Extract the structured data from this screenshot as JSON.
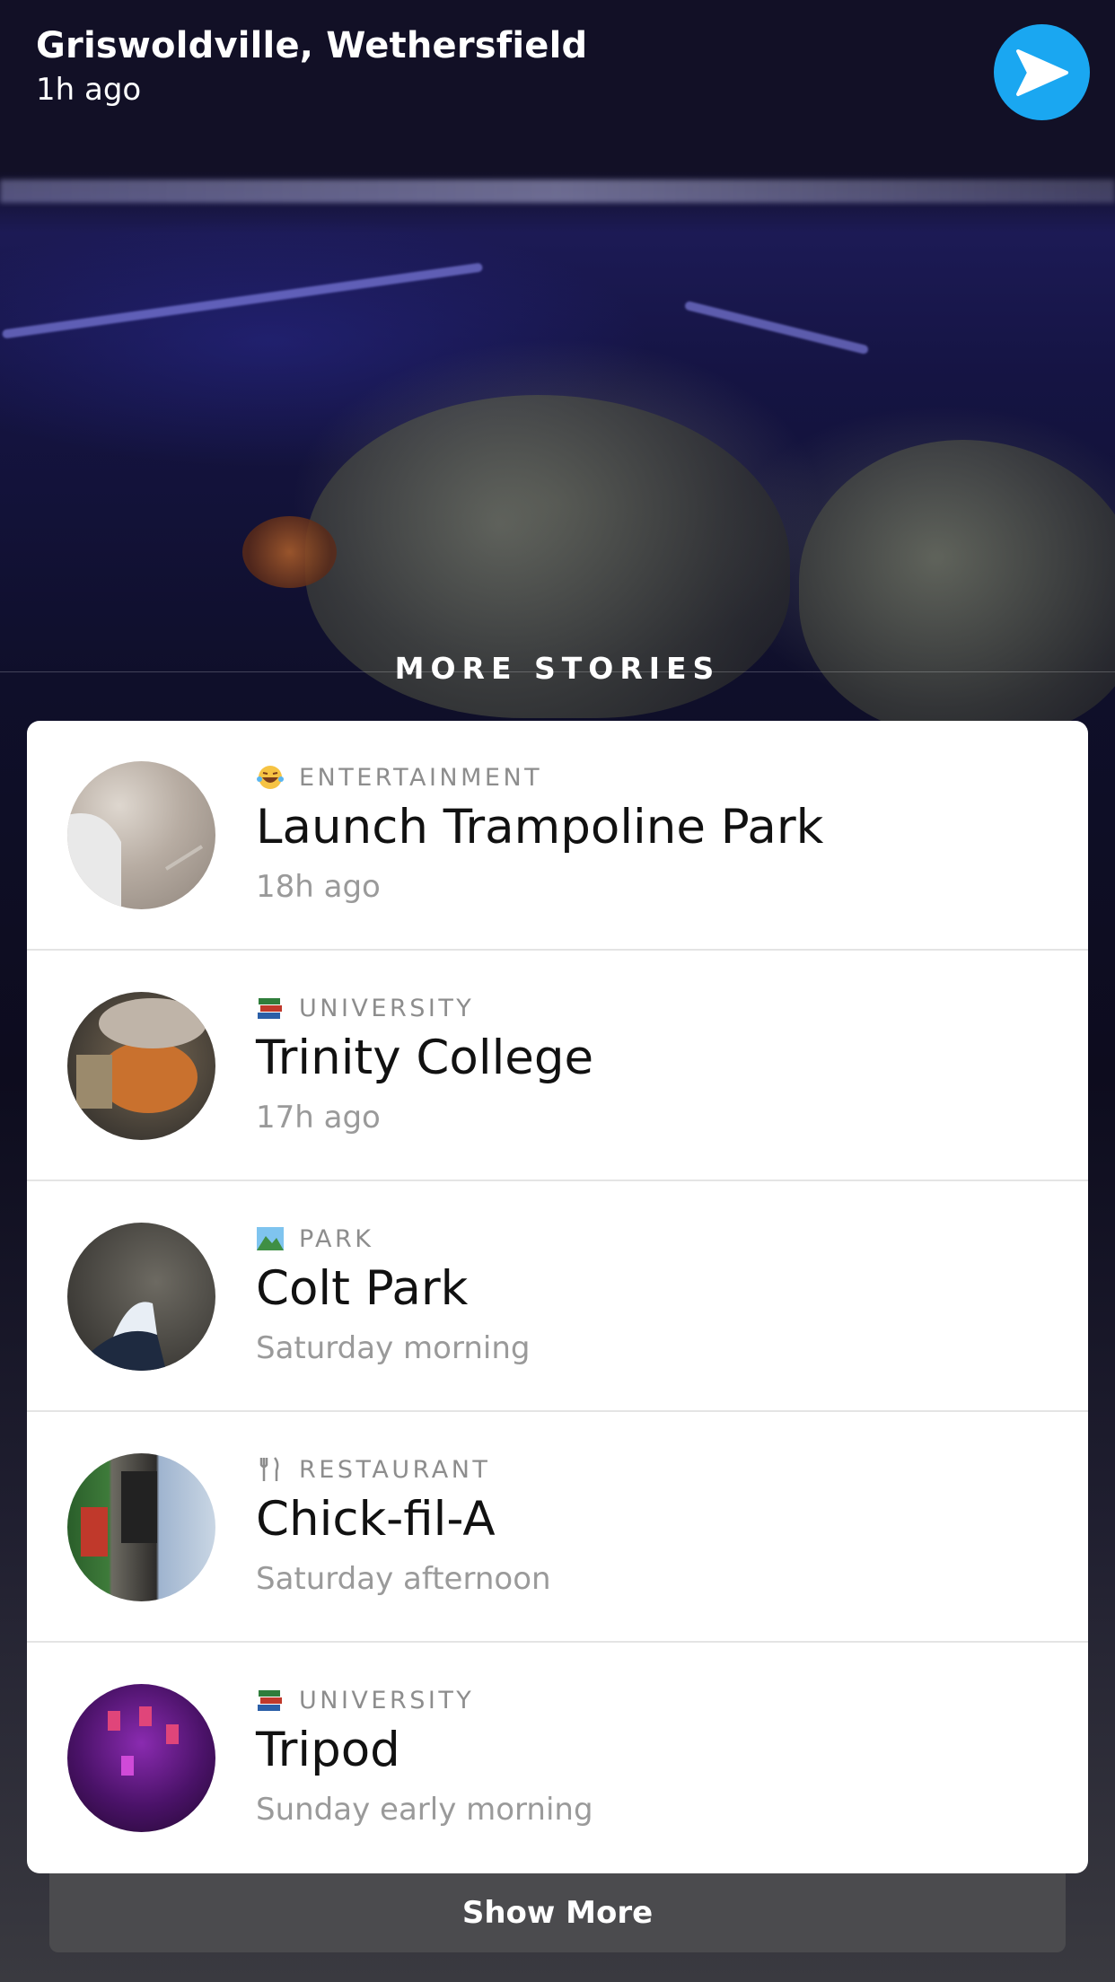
{
  "header": {
    "location": "Griswoldville, Wethersfield",
    "time": "1h ago"
  },
  "section": {
    "title": "MORE STORIES"
  },
  "stories": [
    {
      "category": "ENTERTAINMENT",
      "category_icon": "laughing-face-icon",
      "title": "Launch Trampoline Park",
      "time": "18h ago"
    },
    {
      "category": "UNIVERSITY",
      "category_icon": "books-icon",
      "title": "Trinity College",
      "time": "17h ago"
    },
    {
      "category": "PARK",
      "category_icon": "landscape-icon",
      "title": "Colt Park",
      "time": "Saturday morning"
    },
    {
      "category": "RESTAURANT",
      "category_icon": "fork-knife-icon",
      "title": "Chick-fil-A",
      "time": "Saturday afternoon"
    },
    {
      "category": "UNIVERSITY",
      "category_icon": "books-icon",
      "title": "Tripod",
      "time": "Sunday early morning"
    }
  ],
  "footer": {
    "show_more_label": "Show More"
  },
  "colors": {
    "accent": "#1aa7f1",
    "card": "#ffffff",
    "muted_text": "#9a9a9a"
  }
}
